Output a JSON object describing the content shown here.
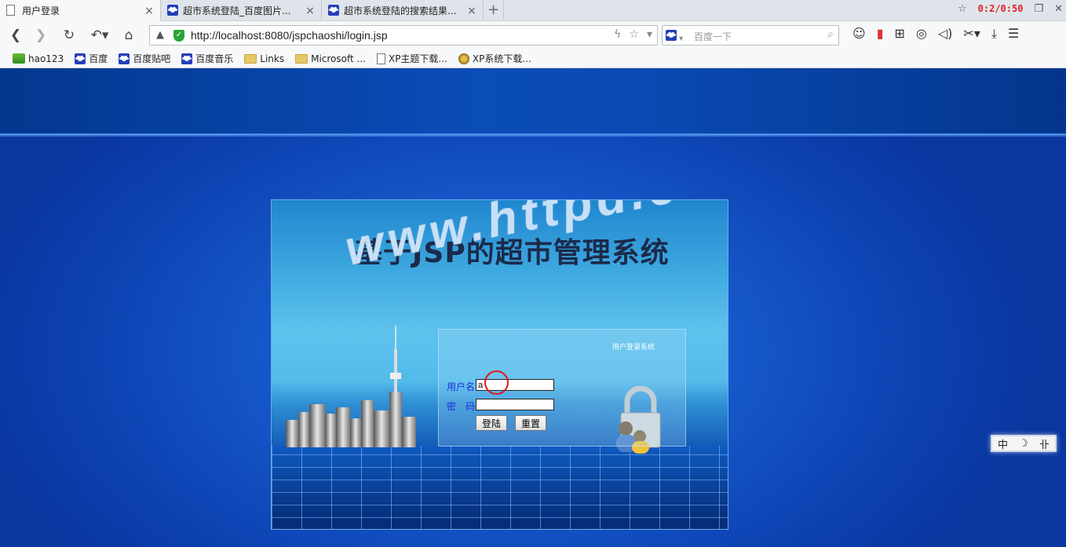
{
  "tabs": [
    {
      "title": "用户登录",
      "active": true,
      "icon": "page-icon"
    },
    {
      "title": "超市系统登陆_百度图片...",
      "active": false,
      "icon": "baidu-paw-icon"
    },
    {
      "title": "超市系统登陆的搜索结果...",
      "active": false,
      "icon": "baidu-paw-icon"
    }
  ],
  "window": {
    "timer": "0:2/0:50"
  },
  "address_bar": {
    "url": "http://localhost:8080/jspchaoshi/login.jsp"
  },
  "search": {
    "placeholder": "百度一下"
  },
  "bookmarks": [
    {
      "label": "hao123",
      "icon": "hao123-icon"
    },
    {
      "label": "百度",
      "icon": "baidu-paw-icon"
    },
    {
      "label": "百度贴吧",
      "icon": "baidu-paw-icon"
    },
    {
      "label": "百度音乐",
      "icon": "baidu-paw-icon"
    },
    {
      "label": "Links",
      "icon": "folder-icon"
    },
    {
      "label": "Microsoft ...",
      "icon": "folder-icon"
    },
    {
      "label": "XP主题下载...",
      "icon": "page-icon"
    },
    {
      "label": "XP系统下载...",
      "icon": "xp-icon"
    }
  ],
  "login": {
    "title": "基于JSP的超市管理系统",
    "watermark": "www.httpd.com",
    "caption": "用户登录系统",
    "username_label": "用户名",
    "username_value": "a",
    "password_label": "密　码",
    "password_value": "",
    "login_button": "登陆",
    "reset_button": "重置"
  },
  "ime_bar": {
    "items": [
      "中",
      "☽",
      "卝"
    ]
  }
}
